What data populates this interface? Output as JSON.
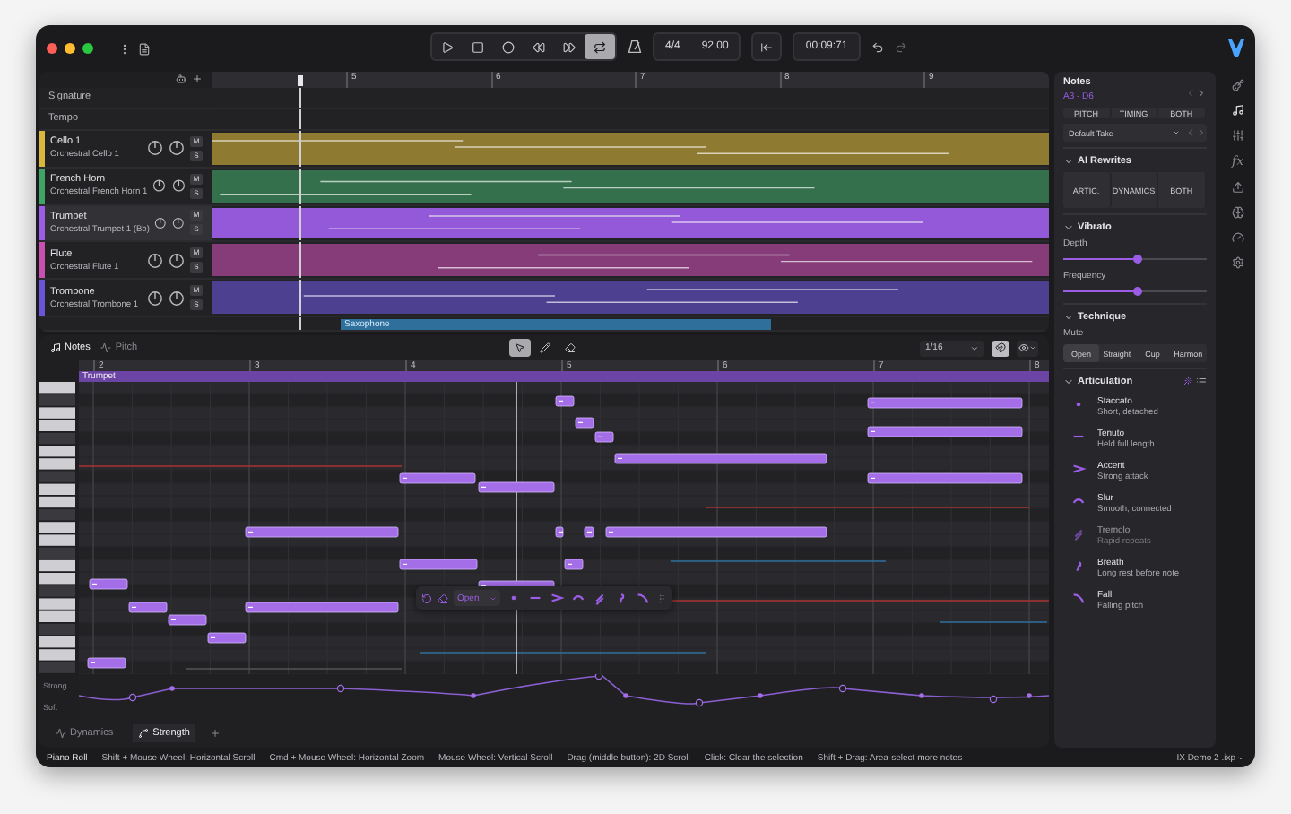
{
  "toolbar": {
    "transport": [
      {
        "kind": "play",
        "selected": false
      },
      {
        "kind": "stop",
        "selected": false
      },
      {
        "kind": "record",
        "selected": false
      },
      {
        "kind": "rewind",
        "selected": false
      },
      {
        "kind": "forward",
        "selected": false
      },
      {
        "kind": "loop",
        "selected": true
      }
    ],
    "time_signature": "4/4",
    "tempo": "92.00",
    "position": "00:09:71"
  },
  "arrange": {
    "ruler": [
      "5",
      "6",
      "7",
      "8",
      "9"
    ],
    "rows": [
      "Signature",
      "Tempo"
    ],
    "tracks": [
      {
        "name": "Cello 1",
        "instrument": "Orchestral Cello 1",
        "color": "#d9b63c",
        "selected": false,
        "mute": "M",
        "solo": "S"
      },
      {
        "name": "French Horn",
        "instrument": "Orchestral French Horn 1",
        "color": "#3fa565",
        "selected": false,
        "mute": "M",
        "solo": "S"
      },
      {
        "name": "Trumpet",
        "instrument": "Orchestral Trumpet 1 (Bb)",
        "color": "#9b5de5",
        "selected": true,
        "mute": "M",
        "solo": "S"
      },
      {
        "name": "Flute",
        "instrument": "Orchestral Flute 1",
        "color": "#c94fb0",
        "selected": false,
        "mute": "M",
        "solo": "S"
      },
      {
        "name": "Trombone",
        "instrument": "Orchestral Trombone 1",
        "color": "#6a55d8",
        "selected": false,
        "mute": "M",
        "solo": "S"
      }
    ],
    "clip_label": "Saxophone"
  },
  "piano_roll": {
    "tabs": [
      {
        "label": "Notes",
        "kind": "notes",
        "selected": true
      },
      {
        "label": "Pitch",
        "kind": "pitch",
        "selected": false
      }
    ],
    "tools": [
      {
        "kind": "pointer",
        "selected": true
      },
      {
        "kind": "pencil",
        "selected": false
      },
      {
        "kind": "eraser",
        "selected": false
      }
    ],
    "snap": "1/16",
    "magnet_on": true,
    "ruler": [
      "2",
      "3",
      "4",
      "5",
      "6",
      "7",
      "8"
    ],
    "clip_name": "Trumpet",
    "technique": "Open",
    "lane_labels": [
      "Strong",
      "Soft"
    ],
    "lanes": [
      {
        "label": "Dynamics",
        "kind": "dynamics",
        "selected": false
      },
      {
        "label": "Strength",
        "kind": "strength",
        "selected": true
      }
    ]
  },
  "inspector": {
    "title": "Notes",
    "range": "A3 - D6",
    "modes": [
      "PITCH",
      "TIMING",
      "BOTH"
    ],
    "take": "Default Take",
    "ai_rewrites": {
      "title": "AI Rewrites",
      "expanded": true,
      "options": [
        "ARTIC.",
        "DYNAMICS",
        "BOTH"
      ]
    },
    "vibrato": {
      "title": "Vibrato",
      "expanded": true,
      "sliders": [
        {
          "label": "Depth",
          "level": 0.52
        },
        {
          "label": "Frequency",
          "level": 0.52
        }
      ]
    },
    "technique": {
      "title": "Technique",
      "expanded": true,
      "label": "Mute",
      "options": [
        {
          "label": "Open",
          "selected": true
        },
        {
          "label": "Straight",
          "selected": false
        },
        {
          "label": "Cup",
          "selected": false
        },
        {
          "label": "Harmon",
          "selected": false
        }
      ]
    },
    "articulation": {
      "title": "Articulation",
      "expanded": true,
      "items": [
        {
          "kind": "staccato",
          "name": "Staccato",
          "description": "Short, detached",
          "disabled": false
        },
        {
          "kind": "tenuto",
          "name": "Tenuto",
          "description": "Held full length",
          "disabled": false
        },
        {
          "kind": "accent",
          "name": "Accent",
          "description": "Strong attack",
          "disabled": false
        },
        {
          "kind": "slur",
          "name": "Slur",
          "description": "Smooth, connected",
          "disabled": false
        },
        {
          "kind": "tremolo",
          "name": "Tremolo",
          "description": "Rapid repeats",
          "disabled": true
        },
        {
          "kind": "breath",
          "name": "Breath",
          "description": "Long rest before note",
          "disabled": false
        },
        {
          "kind": "fall",
          "name": "Fall",
          "description": "Falling pitch",
          "disabled": false
        }
      ]
    }
  },
  "rail": [
    {
      "kind": "instrument",
      "selected": false
    },
    {
      "kind": "notes",
      "selected": true
    },
    {
      "kind": "mixer",
      "selected": false
    },
    {
      "kind": "effects",
      "label": "fx",
      "selected": false
    },
    {
      "kind": "export",
      "selected": false
    },
    {
      "kind": "ai",
      "selected": false
    },
    {
      "kind": "performance",
      "selected": false
    },
    {
      "kind": "settings",
      "selected": false
    }
  ],
  "status_bar": {
    "mode": "Piano Roll",
    "hints": [
      "Shift + Mouse Wheel: Horizontal Scroll",
      "Cmd + Mouse Wheel: Horizontal Zoom",
      "Mouse Wheel: Vertical Scroll",
      "Drag (middle button): 2D Scroll",
      "Click: Clear the selection",
      "Shift + Drag: Area-select more notes"
    ],
    "project": "IX Demo 2 .ixp"
  }
}
